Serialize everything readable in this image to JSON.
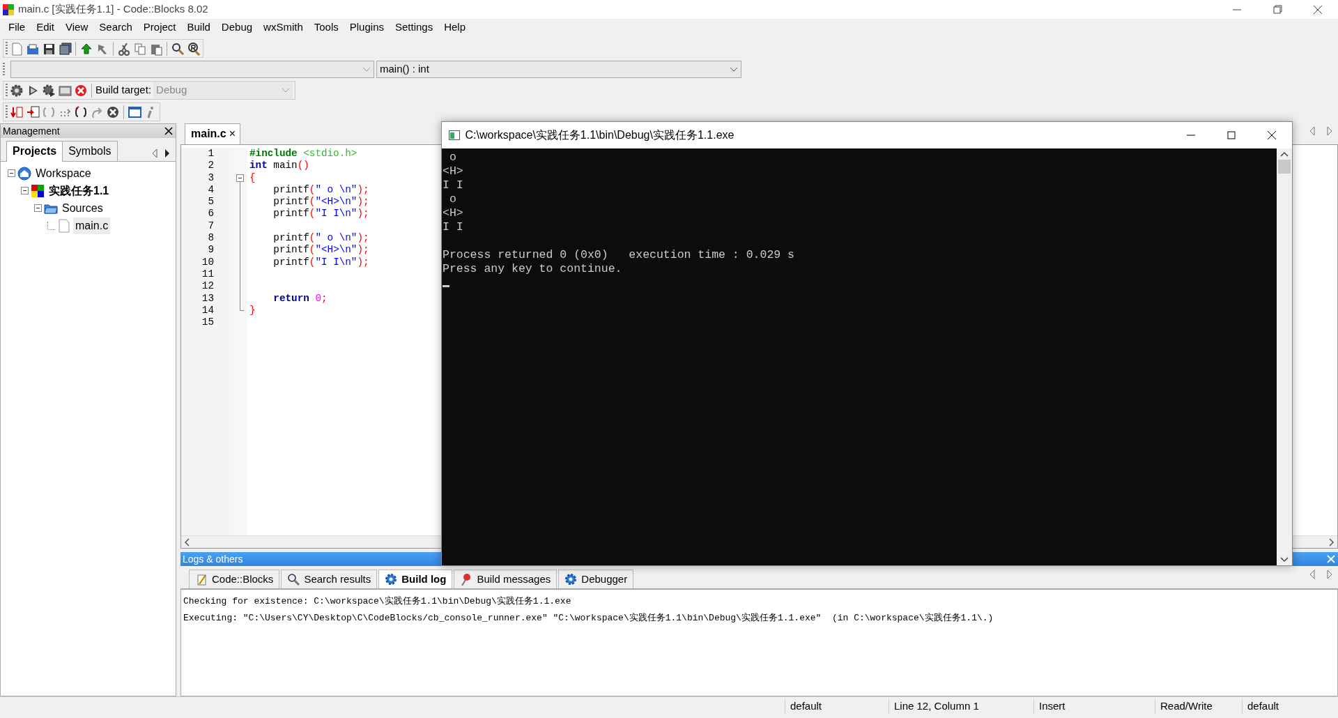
{
  "window": {
    "title": "main.c [实践任务1.1] - Code::Blocks 8.02"
  },
  "menu": [
    "File",
    "Edit",
    "View",
    "Search",
    "Project",
    "Build",
    "Debug",
    "wxSmith",
    "Tools",
    "Plugins",
    "Settings",
    "Help"
  ],
  "function_combo": {
    "value": "main() : int"
  },
  "build_target": {
    "label": "Build target:",
    "value": "Debug"
  },
  "management": {
    "title": "Management",
    "tabs": [
      {
        "label": "Projects",
        "selected": true
      },
      {
        "label": "Symbols",
        "selected": false
      }
    ],
    "tree": [
      {
        "label": "Workspace",
        "kind": "workspace",
        "expanded": true,
        "selected": false,
        "children": [
          {
            "label": "实践任务1.1",
            "kind": "project",
            "expanded": true,
            "selected": false,
            "children": [
              {
                "label": "Sources",
                "kind": "folder",
                "expanded": true,
                "selected": false,
                "children": [
                  {
                    "label": "main.c",
                    "kind": "file",
                    "selected": true
                  }
                ]
              }
            ]
          }
        ]
      }
    ]
  },
  "editor": {
    "tabs": [
      {
        "label": "main.c",
        "selected": true,
        "close": "×"
      }
    ],
    "lines": [
      {
        "number": "1",
        "tokens": [
          {
            "kind": "pp",
            "text": "#include"
          },
          {
            "kind": "ppfile",
            "text": " <stdio.h>"
          }
        ]
      },
      {
        "number": "2",
        "tokens": [
          {
            "kind": "keyword",
            "text": "int"
          },
          {
            "kind": "plain",
            "text": " main"
          },
          {
            "kind": "op",
            "text": "()"
          }
        ]
      },
      {
        "number": "3",
        "kind": "fold-start",
        "tokens": [
          {
            "kind": "op",
            "text": "{"
          }
        ]
      },
      {
        "number": "4",
        "tokens": [
          {
            "kind": "plain",
            "text": "    printf"
          },
          {
            "kind": "op",
            "text": "("
          },
          {
            "kind": "string",
            "text": "\" o \\n\""
          },
          {
            "kind": "op",
            "text": ");"
          }
        ]
      },
      {
        "number": "5",
        "tokens": [
          {
            "kind": "plain",
            "text": "    printf"
          },
          {
            "kind": "op",
            "text": "("
          },
          {
            "kind": "string",
            "text": "\"<H>\\n\""
          },
          {
            "kind": "op",
            "text": ");"
          }
        ]
      },
      {
        "number": "6",
        "tokens": [
          {
            "kind": "plain",
            "text": "    printf"
          },
          {
            "kind": "op",
            "text": "("
          },
          {
            "kind": "string",
            "text": "\"I I\\n\""
          },
          {
            "kind": "op",
            "text": ");"
          }
        ]
      },
      {
        "number": "7"
      },
      {
        "number": "8",
        "tokens": [
          {
            "kind": "plain",
            "text": "    printf"
          },
          {
            "kind": "op",
            "text": "("
          },
          {
            "kind": "string",
            "text": "\" o \\n\""
          },
          {
            "kind": "op",
            "text": ");"
          }
        ]
      },
      {
        "number": "9",
        "tokens": [
          {
            "kind": "plain",
            "text": "    printf"
          },
          {
            "kind": "op",
            "text": "("
          },
          {
            "kind": "string",
            "text": "\"<H>\\n\""
          },
          {
            "kind": "op",
            "text": ");"
          }
        ]
      },
      {
        "number": "10",
        "tokens": [
          {
            "kind": "plain",
            "text": "    printf"
          },
          {
            "kind": "op",
            "text": "("
          },
          {
            "kind": "string",
            "text": "\"I I\\n\""
          },
          {
            "kind": "op",
            "text": ");"
          }
        ]
      },
      {
        "number": "11"
      },
      {
        "number": "12"
      },
      {
        "number": "13",
        "tokens": [
          {
            "kind": "keyword",
            "text": "    return"
          },
          {
            "kind": "number",
            "text": " 0"
          },
          {
            "kind": "op",
            "text": ";"
          }
        ]
      },
      {
        "number": "14",
        "kind": "fold-end",
        "tokens": [
          {
            "kind": "op",
            "text": "}"
          }
        ]
      },
      {
        "number": "15"
      }
    ]
  },
  "console": {
    "title": "C:\\workspace\\实践任务1.1\\bin\\Debug\\实践任务1.1.exe",
    "output": [
      " o",
      "<H>",
      "I I",
      " o",
      "<H>",
      "I I"
    ],
    "messages": [
      "Process returned 0 (0x0)   execution time : 0.029 s",
      "Press any key to continue."
    ],
    "cursor": true
  },
  "logs": {
    "title": "Logs & others",
    "tabs": [
      {
        "label": "Code::Blocks",
        "kind": "note",
        "selected": false
      },
      {
        "label": "Search results",
        "kind": "search",
        "selected": false
      },
      {
        "label": "Build log",
        "kind": "gear",
        "selected": true
      },
      {
        "label": "Build messages",
        "kind": "pin",
        "selected": false
      },
      {
        "label": "Debugger",
        "kind": "gear",
        "selected": false
      }
    ],
    "lines": [
      "Checking for existence: C:\\workspace\\实践任务1.1\\bin\\Debug\\实践任务1.1.exe",
      "Executing: \"C:\\Users\\CY\\Desktop\\C\\CodeBlocks/cb_console_runner.exe\" \"C:\\workspace\\实践任务1.1\\bin\\Debug\\实践任务1.1.exe\"  (in C:\\workspace\\实践任务1.1\\.)"
    ]
  },
  "status_bar": [
    "default",
    "Line 12, Column 1",
    "Insert",
    "Read/Write",
    "default"
  ]
}
